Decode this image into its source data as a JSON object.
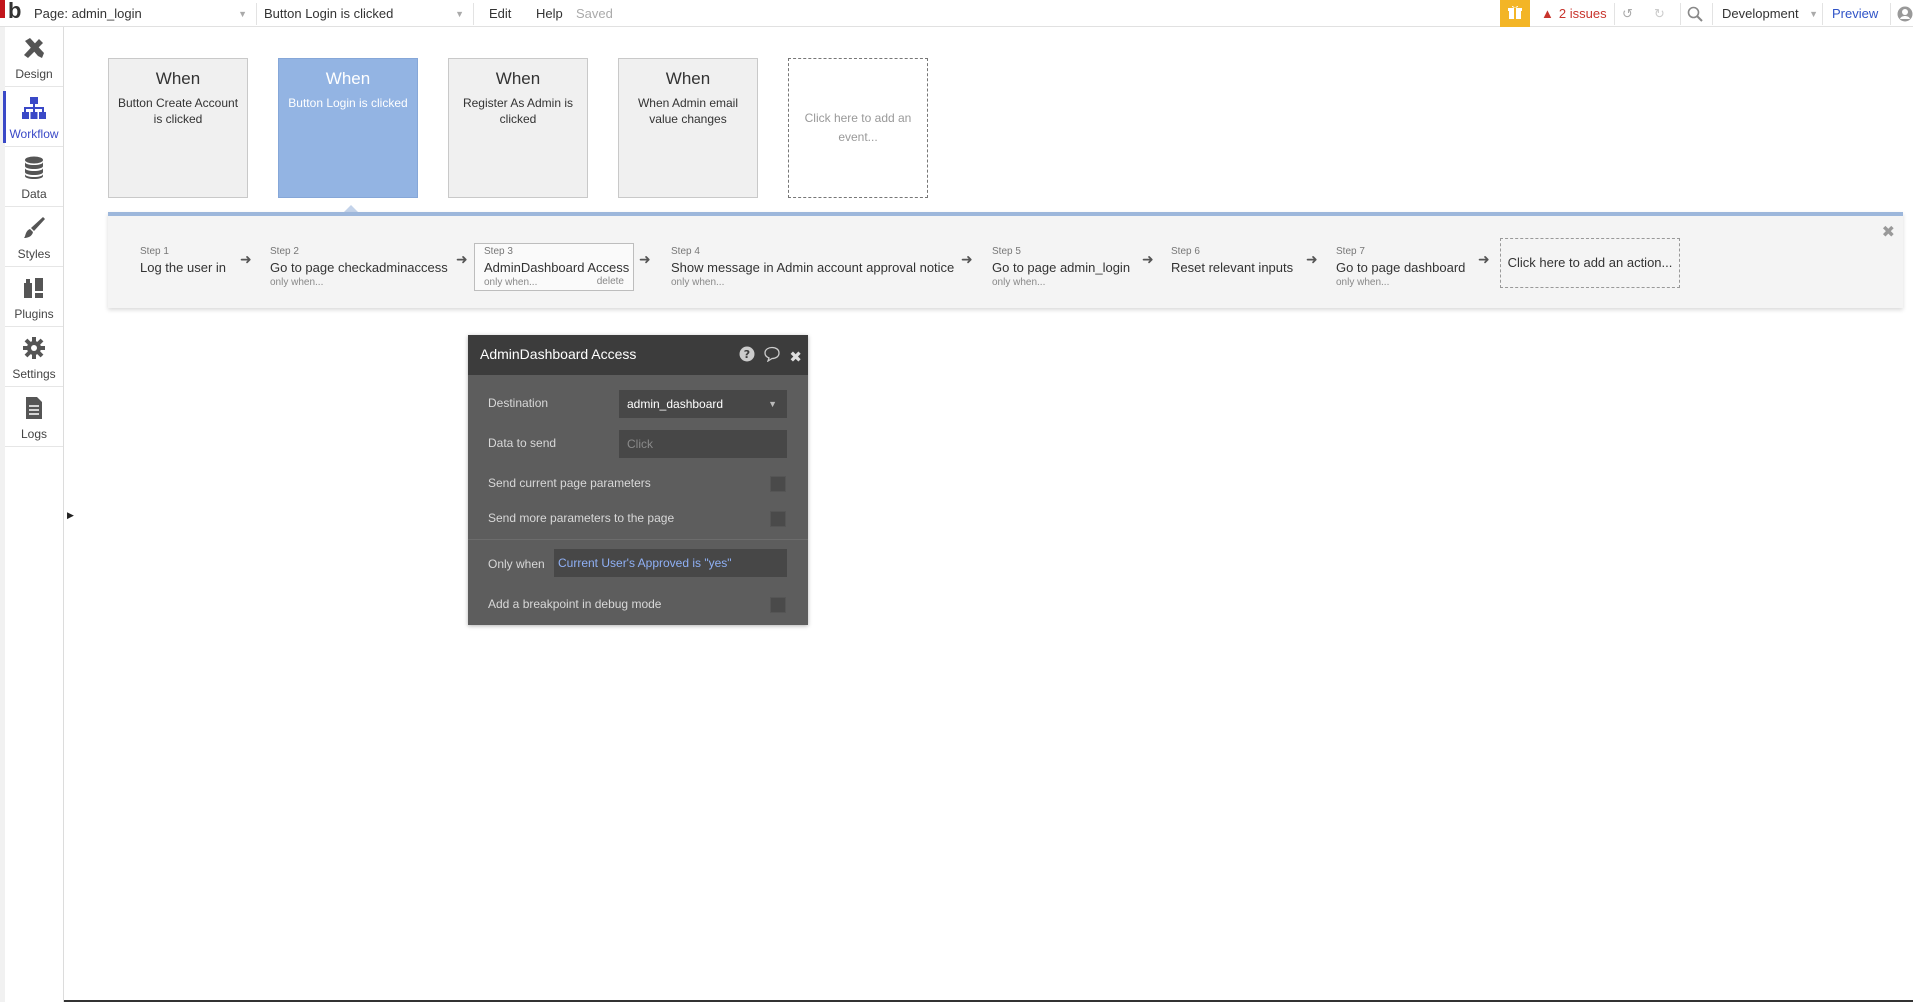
{
  "topbar": {
    "page_select": "Page: admin_login",
    "workflow_select": "Button Login is clicked",
    "menu": [
      "Edit",
      "Help"
    ],
    "status": "Saved",
    "issues": "2 issues",
    "environment": "Development",
    "preview": "Preview"
  },
  "sidebar": {
    "items": [
      {
        "label": "Design",
        "icon": "design-icon"
      },
      {
        "label": "Workflow",
        "icon": "workflow-icon"
      },
      {
        "label": "Data",
        "icon": "database-icon"
      },
      {
        "label": "Styles",
        "icon": "brush-icon"
      },
      {
        "label": "Plugins",
        "icon": "plugin-icon"
      },
      {
        "label": "Settings",
        "icon": "gear-icon"
      },
      {
        "label": "Logs",
        "icon": "document-icon"
      }
    ],
    "active": "Workflow"
  },
  "events": [
    {
      "when": "When",
      "desc": "Button Create Account is clicked"
    },
    {
      "when": "When",
      "desc": "Button Login is clicked"
    },
    {
      "when": "When",
      "desc": "Register As Admin is clicked"
    },
    {
      "when": "When",
      "desc": "When Admin email value changes"
    }
  ],
  "event_add": "Click here to add an event...",
  "steps": [
    {
      "num": "Step 1",
      "name": "Log the user in",
      "onlywhen": ""
    },
    {
      "num": "Step 2",
      "name": "Go to page checkadminaccess",
      "onlywhen": "only when..."
    },
    {
      "num": "Step 3",
      "name": "AdminDashboard Access",
      "onlywhen": "only when...",
      "delete": "delete"
    },
    {
      "num": "Step 4",
      "name": "Show message in Admin account approval notice",
      "onlywhen": "only when..."
    },
    {
      "num": "Step 5",
      "name": "Go to page admin_login",
      "onlywhen": "only when..."
    },
    {
      "num": "Step 6",
      "name": "Reset relevant inputs",
      "onlywhen": ""
    },
    {
      "num": "Step 7",
      "name": "Go to page dashboard",
      "onlywhen": "only when..."
    }
  ],
  "step_add": "Click here to add an action...",
  "panel": {
    "title": "AdminDashboard Access",
    "destination_label": "Destination",
    "destination_value": "admin_dashboard",
    "data_label": "Data to send",
    "data_placeholder": "Click",
    "send_current_label": "Send current page parameters",
    "send_more_label": "Send more parameters to the page",
    "only_when_label": "Only when",
    "only_when_value": "Current User's Approved is \"yes\"",
    "breakpoint_label": "Add a breakpoint in debug mode"
  },
  "colors": {
    "accent": "#3a49c7",
    "selected_event": "#93b4e3",
    "issues": "#c8342c",
    "only_when_expr": "#8fb0f5"
  }
}
